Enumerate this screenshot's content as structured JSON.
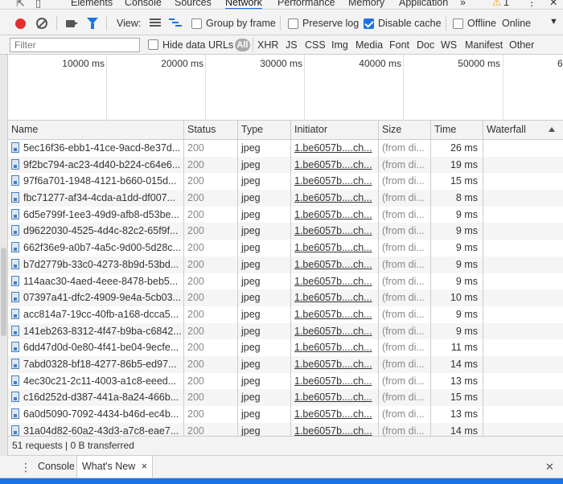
{
  "devtools_tabs": [
    "Elements",
    "Console",
    "Sources",
    "Network",
    "Performance",
    "Memory",
    "Application"
  ],
  "active_tab": "Network",
  "more_tabs": "»",
  "warnings": {
    "icon": "warning-icon",
    "count": "1"
  },
  "menu": "⋮",
  "close": "✕",
  "toolbar": {
    "view_label": "View:",
    "group_by_frame": "Group by frame",
    "preserve_log": "Preserve log",
    "disable_cache": "Disable cache",
    "disable_cache_checked": true,
    "offline": "Offline",
    "throttle_value": "Online"
  },
  "filter": {
    "placeholder": "Filter",
    "hide_data_urls": "Hide data URLs",
    "all": "All",
    "types": [
      "XHR",
      "JS",
      "CSS",
      "Img",
      "Media",
      "Font",
      "Doc",
      "WS",
      "Manifest",
      "Other"
    ]
  },
  "timeline": {
    "ticks": [
      "10000 ms",
      "20000 ms",
      "30000 ms",
      "40000 ms",
      "50000 ms",
      "6"
    ]
  },
  "columns": [
    "Name",
    "Status",
    "Type",
    "Initiator",
    "Size",
    "Time",
    "Waterfall"
  ],
  "rows": [
    {
      "name": "5ec16f36-ebb1-41ce-9acd-8e37d...",
      "status": "200",
      "type": "jpeg",
      "initiator": "1.be6057b....ch...",
      "size": "(from di...",
      "time": "26 ms"
    },
    {
      "name": "9f2bc794-ac23-4d40-b224-c64e6...",
      "status": "200",
      "type": "jpeg",
      "initiator": "1.be6057b....ch...",
      "size": "(from di...",
      "time": "19 ms"
    },
    {
      "name": "97f6a701-1948-4121-b660-015d...",
      "status": "200",
      "type": "jpeg",
      "initiator": "1.be6057b....ch...",
      "size": "(from di...",
      "time": "15 ms"
    },
    {
      "name": "fbc71277-af34-4cda-a1dd-df007...",
      "status": "200",
      "type": "jpeg",
      "initiator": "1.be6057b....ch...",
      "size": "(from di...",
      "time": "8 ms"
    },
    {
      "name": "6d5e799f-1ee3-49d9-afb8-d53be...",
      "status": "200",
      "type": "jpeg",
      "initiator": "1.be6057b....ch...",
      "size": "(from di...",
      "time": "9 ms"
    },
    {
      "name": "d9622030-4525-4d4c-82c2-65f9f...",
      "status": "200",
      "type": "jpeg",
      "initiator": "1.be6057b....ch...",
      "size": "(from di...",
      "time": "9 ms"
    },
    {
      "name": "662f36e9-a0b7-4a5c-9d00-5d28c...",
      "status": "200",
      "type": "jpeg",
      "initiator": "1.be6057b....ch...",
      "size": "(from di...",
      "time": "9 ms"
    },
    {
      "name": "b7d2779b-33c0-4273-8b9d-53bd...",
      "status": "200",
      "type": "jpeg",
      "initiator": "1.be6057b....ch...",
      "size": "(from di...",
      "time": "9 ms"
    },
    {
      "name": "114aac30-4aed-4eee-8478-beb5...",
      "status": "200",
      "type": "jpeg",
      "initiator": "1.be6057b....ch...",
      "size": "(from di...",
      "time": "9 ms"
    },
    {
      "name": "07397a41-dfc2-4909-9e4a-5cb03...",
      "status": "200",
      "type": "jpeg",
      "initiator": "1.be6057b....ch...",
      "size": "(from di...",
      "time": "10 ms"
    },
    {
      "name": "acc814a7-19cc-40fb-a168-dcca5...",
      "status": "200",
      "type": "jpeg",
      "initiator": "1.be6057b....ch...",
      "size": "(from di...",
      "time": "9 ms"
    },
    {
      "name": "141eb263-8312-4f47-b9ba-c6842...",
      "status": "200",
      "type": "jpeg",
      "initiator": "1.be6057b....ch...",
      "size": "(from di...",
      "time": "9 ms"
    },
    {
      "name": "6dd47d0d-0e80-4f41-be04-9ecfe...",
      "status": "200",
      "type": "jpeg",
      "initiator": "1.be6057b....ch...",
      "size": "(from di...",
      "time": "11 ms"
    },
    {
      "name": "7abd0328-bf18-4277-86b5-ed97...",
      "status": "200",
      "type": "jpeg",
      "initiator": "1.be6057b....ch...",
      "size": "(from di...",
      "time": "14 ms"
    },
    {
      "name": "4ec30c21-2c11-4003-a1c8-eeed...",
      "status": "200",
      "type": "jpeg",
      "initiator": "1.be6057b....ch...",
      "size": "(from di...",
      "time": "13 ms"
    },
    {
      "name": "c16d252d-d387-441a-8a24-466b...",
      "status": "200",
      "type": "jpeg",
      "initiator": "1.be6057b....ch...",
      "size": "(from di...",
      "time": "15 ms"
    },
    {
      "name": "6a0d5090-7092-4434-b46d-ec4b...",
      "status": "200",
      "type": "jpeg",
      "initiator": "1.be6057b....ch...",
      "size": "(from di...",
      "time": "13 ms"
    },
    {
      "name": "31a04d82-60a2-43d3-a7c8-eae7...",
      "status": "200",
      "type": "jpeg",
      "initiator": "1.be6057b....ch...",
      "size": "(from di...",
      "time": "14 ms"
    }
  ],
  "summary": "51 requests | 0 B transferred",
  "drawer": {
    "tabs": [
      "Console",
      "What's New"
    ],
    "active": "What's New",
    "tab_close": "×",
    "close": "✕"
  },
  "colors": {
    "accent": "#1a73e8",
    "record": "#e0302f"
  }
}
